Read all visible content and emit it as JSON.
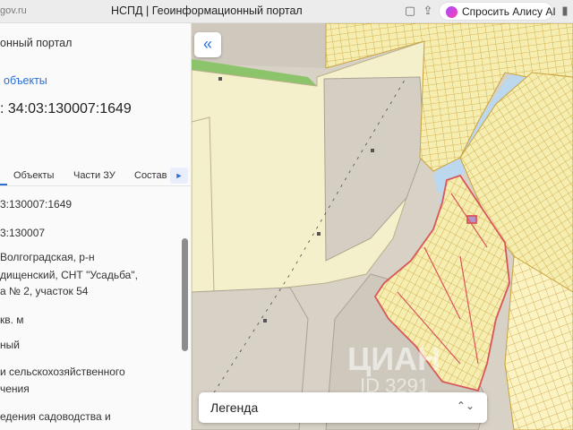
{
  "browser": {
    "url": "gov.ru",
    "title": "НСПД | Геоинформационный портал",
    "alice_label": "Спросить Алису AI",
    "icons": [
      "tabs-icon",
      "share-icon",
      "bookmark-icon"
    ]
  },
  "panel": {
    "portal": "онный портал",
    "objects_link": "объекты",
    "cadastral_title": ": 34:03:130007:1649",
    "tabs": [
      {
        "label": "Объекты"
      },
      {
        "label": "Части ЗУ"
      },
      {
        "label": "Состав"
      }
    ],
    "more_icon": "chevron-right-icon",
    "fields": [
      {
        "text": "3:130007:1649"
      },
      {
        "text": "3:130007"
      },
      {
        "text": "Волгоградская, р-н"
      },
      {
        "text": "дищенский, СНТ \"Усадьба\","
      },
      {
        "text": "а № 2, участок 54"
      },
      {
        "text": "кв. м"
      },
      {
        "text": "ный"
      },
      {
        "text": "и сельскохозяйственного"
      },
      {
        "text": "чения"
      },
      {
        "text": "едения садоводства и"
      }
    ]
  },
  "map": {
    "collapse_icon": "double-chevron-left-icon",
    "legend_label": "Легенда",
    "legend_icon": "up-down-chevron-icon",
    "watermark": "ЦИАН",
    "watermark_id": "ID 3291"
  },
  "colors": {
    "link": "#2a6fd1",
    "parcel_fill": "#f6eeb0",
    "parcel_line": "#c9a23c",
    "highlight": "#d9555a",
    "land_gray": "#d7d1c6",
    "water": "#bcd8ef",
    "green": "#8cc46c"
  }
}
